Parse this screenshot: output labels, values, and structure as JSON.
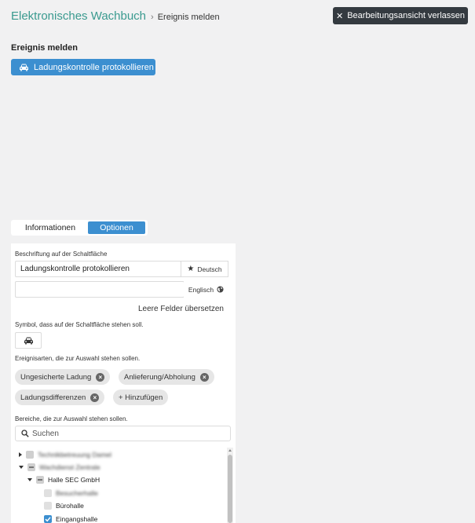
{
  "header": {
    "app_title": "Elektronisches Wachbuch",
    "separator": "›",
    "current_page": "Ereignis melden",
    "exit_button": "Bearbeitungsansicht verlassen"
  },
  "section": {
    "title": "Ereignis melden",
    "action_button": "Ladungskontrolle protokollieren"
  },
  "tabs": [
    {
      "label": "Informationen",
      "active": false
    },
    {
      "label": "Optionen",
      "active": true
    }
  ],
  "options": {
    "caption_label": "Beschriftung auf der Schaltfläche",
    "caption_de_value": "Ladungskontrolle protokollieren",
    "lang_de": "Deutsch",
    "caption_en_value": "",
    "lang_en": "Englisch",
    "translate_link": "Leere Felder übersetzen",
    "symbol_label": "Symbol, dass auf der Schaltfläche stehen soll.",
    "event_types_label": "Ereignisarten, die zur Auswahl stehen sollen.",
    "event_types": [
      "Ungesicherte Ladung",
      "Anlieferung/Abholung",
      "Ladungsdifferenzen"
    ],
    "add_label": "+ Hinzufügen",
    "areas_label": "Bereiche, die zur Auswahl stehen sollen.",
    "search_placeholder": "Suchen",
    "tree": {
      "node_1": "Technikbetreuung Damel",
      "node_2": "Wachdienst Zentrale",
      "node_3": "Halle SEC GmbH",
      "node_4": "Besucherhalle",
      "node_5": "Bürohalle",
      "node_6": "Eingangshalle"
    }
  },
  "colors": {
    "accent": "#3c8fd0",
    "title_teal": "#3a9a8f",
    "dark_button": "#343a40"
  }
}
